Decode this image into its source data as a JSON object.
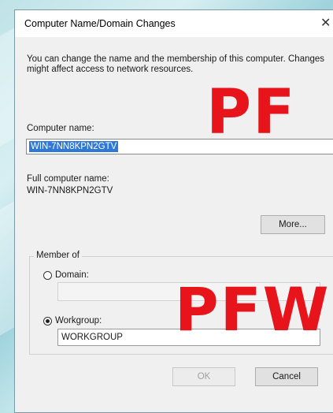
{
  "window": {
    "title": "Computer Name/Domain Changes",
    "close_glyph": "✕"
  },
  "description": "You can change the name and the membership of this computer. Changes might affect access to network resources.",
  "computer_name": {
    "label": "Computer name:",
    "value": "WIN-7NN8KPN2GTV"
  },
  "full_name": {
    "label": "Full computer name:",
    "value": "WIN-7NN8KPN2GTV"
  },
  "more_button": "More...",
  "member_of": {
    "legend": "Member of",
    "domain": {
      "label": "Domain:",
      "selected": false,
      "value": ""
    },
    "workgroup": {
      "label": "Workgroup:",
      "selected": true,
      "value": "WORKGROUP"
    }
  },
  "buttons": {
    "ok": "OK",
    "cancel": "Cancel"
  },
  "annotations": {
    "top": "PF",
    "bottom": "PFW"
  },
  "colors": {
    "selection": "#3078d6",
    "annotation": "#e8141c"
  }
}
